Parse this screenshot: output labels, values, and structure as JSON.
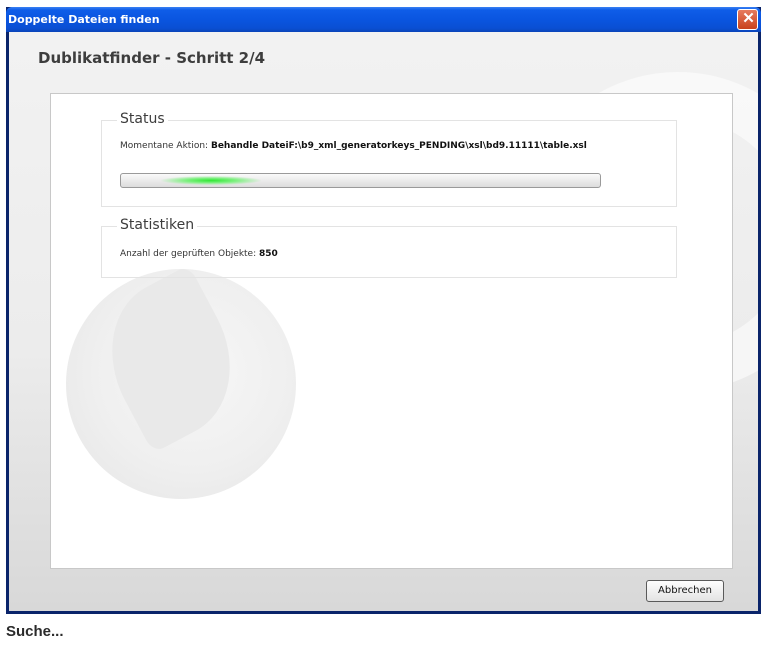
{
  "window": {
    "title": "Doppelte Dateien finden",
    "close_glyph": "✕"
  },
  "wizard": {
    "heading": "Dublikatfinder - Schritt 2/4"
  },
  "status": {
    "legend": "Status",
    "action_label": "Momentane Aktion:",
    "action_value": "Behandle DateiF:\\b9_xml_generatorkeys_PENDING\\xsl\\bd9.11111\\table.xsl",
    "progress": "indeterminate"
  },
  "stats": {
    "legend": "Statistiken",
    "checked_label": "Anzahl der geprüften Objekte:",
    "checked_value": "850"
  },
  "buttons": {
    "cancel": "Abbrechen"
  },
  "footer": {
    "status_text": "Suche..."
  },
  "colors": {
    "titlebar": "#0a55e0",
    "progress_glow": "#2ee832",
    "close_button": "#c8411c"
  }
}
